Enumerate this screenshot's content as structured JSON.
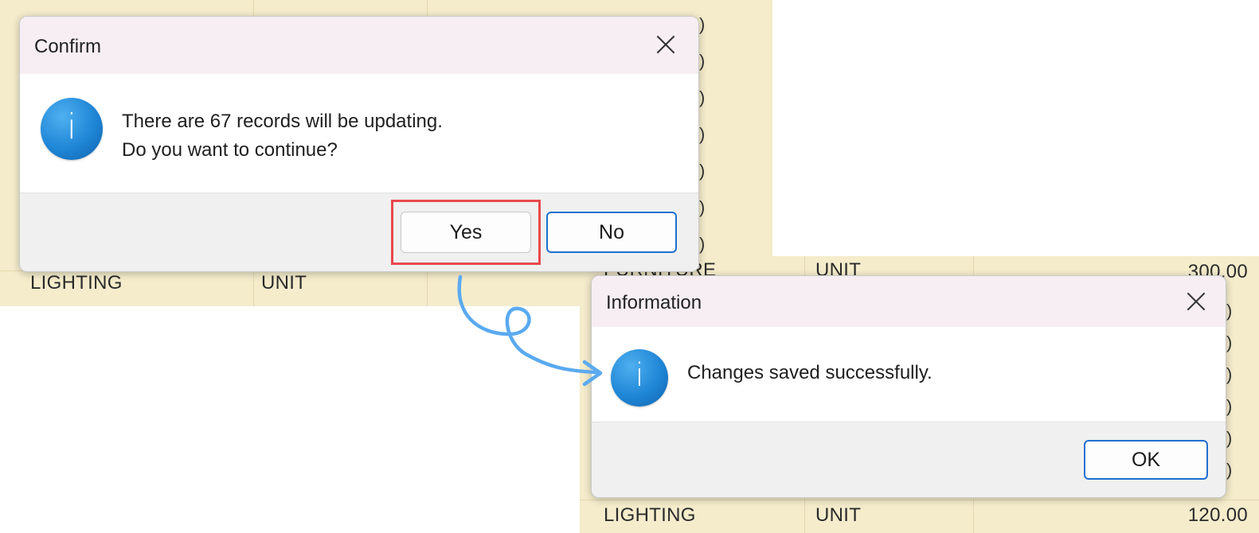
{
  "confirm_dialog": {
    "title": "Confirm",
    "message_line1": "There are 67 records will be updating.",
    "message_line2": "Do you want to continue?",
    "yes_label": "Yes",
    "no_label": "No",
    "icon": "info-icon"
  },
  "info_dialog": {
    "title": "Information",
    "message": "Changes saved successfully.",
    "ok_label": "OK",
    "icon": "info-icon"
  },
  "background_grid_left": {
    "row_category": "LIGHTING",
    "row_unit": "UNIT"
  },
  "background_grid_right": {
    "top_row_category": "FURNITURE",
    "top_row_unit": "UNIT",
    "top_row_value": "300.00",
    "bottom_row_category": "LIGHTING",
    "bottom_row_unit": "UNIT",
    "bottom_row_value": "120.00"
  },
  "colors": {
    "grid_background": "#f4eccb",
    "highlight": "#e8484d",
    "arrow": "#5aaaf0",
    "icon_blue": "#1f86d6"
  }
}
